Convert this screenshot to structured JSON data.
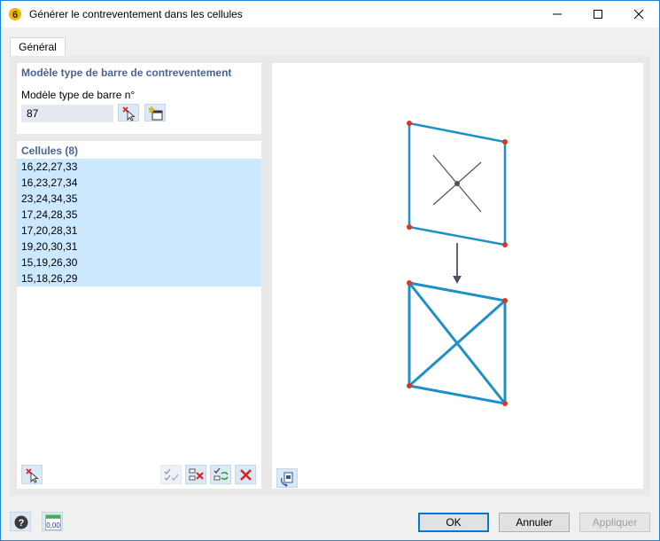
{
  "window": {
    "title": "Générer le contreventement dans les cellules"
  },
  "tabs": [
    {
      "label": "Général",
      "active": true
    }
  ],
  "bracing": {
    "section_title": "Modèle type de barre de contreventement",
    "field_label": "Modèle type de barre n°",
    "field_value": "87"
  },
  "cells": {
    "section_title": "Cellules (8)",
    "items": [
      "16,22,27,33",
      "16,23,27,34",
      "23,24,34,35",
      "17,24,28,35",
      "17,20,28,31",
      "19,20,30,31",
      "15,19,26,30",
      "15,18,26,29"
    ]
  },
  "footer": {
    "ok_label": "OK",
    "cancel_label": "Annuler",
    "apply_label": "Appliquer",
    "units_icon_text": "0,00"
  },
  "colors": {
    "accent": "#1883d7",
    "selection": "#cce8ff",
    "section_title": "#4a6491",
    "diagram_line": "#1e90c8",
    "diagram_node": "#d9381e",
    "delete_red": "#e02020"
  }
}
